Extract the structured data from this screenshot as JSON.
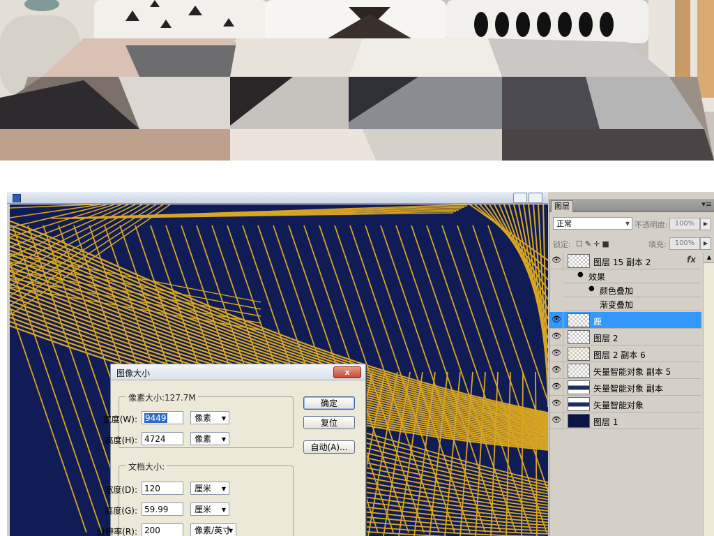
{
  "document": {
    "title": "",
    "canvas_bg": "#0f1c55",
    "gold": "#d9a621"
  },
  "dialog": {
    "title": "图像大小",
    "close": "x",
    "pixel_group_label": "像素大小:127.7M",
    "pixel_width_label": "宽度(W):",
    "pixel_width_value": "9449",
    "pixel_width_unit": "像素",
    "pixel_height_label": "高度(H):",
    "pixel_height_value": "4724",
    "pixel_height_unit": "像素",
    "doc_group_label": "文档大小:",
    "doc_width_label": "宽度(D):",
    "doc_width_value": "120",
    "doc_width_unit": "厘米",
    "doc_height_label": "高度(G):",
    "doc_height_value": "59.99",
    "doc_height_unit": "厘米",
    "resolution_label": "分辨率(R):",
    "resolution_value": "200",
    "resolution_unit": "像素/英寸",
    "ok_button": "确定",
    "reset_button": "复位",
    "auto_button": "自动(A)..."
  },
  "layers_panel": {
    "tab": "图层",
    "blend_mode": "正常",
    "opacity_label": "不透明度:",
    "opacity_value": "100%",
    "lock_label": "锁定:",
    "fill_label": "填充:",
    "fill_value": "100%",
    "fx_label": "fx",
    "layers": [
      {
        "name": "图层 15 副本 2"
      },
      {
        "name": "鹿"
      },
      {
        "name": "图层 2"
      },
      {
        "name": "图层 2 副本 6"
      },
      {
        "name": "矢量智能对象 副本 5"
      },
      {
        "name": "矢量智能对象 副本"
      },
      {
        "name": "矢量智能对象"
      },
      {
        "name": "图层 1"
      }
    ],
    "effects": {
      "group": "效果",
      "items": [
        "颜色叠加",
        "渐变叠加"
      ]
    }
  }
}
